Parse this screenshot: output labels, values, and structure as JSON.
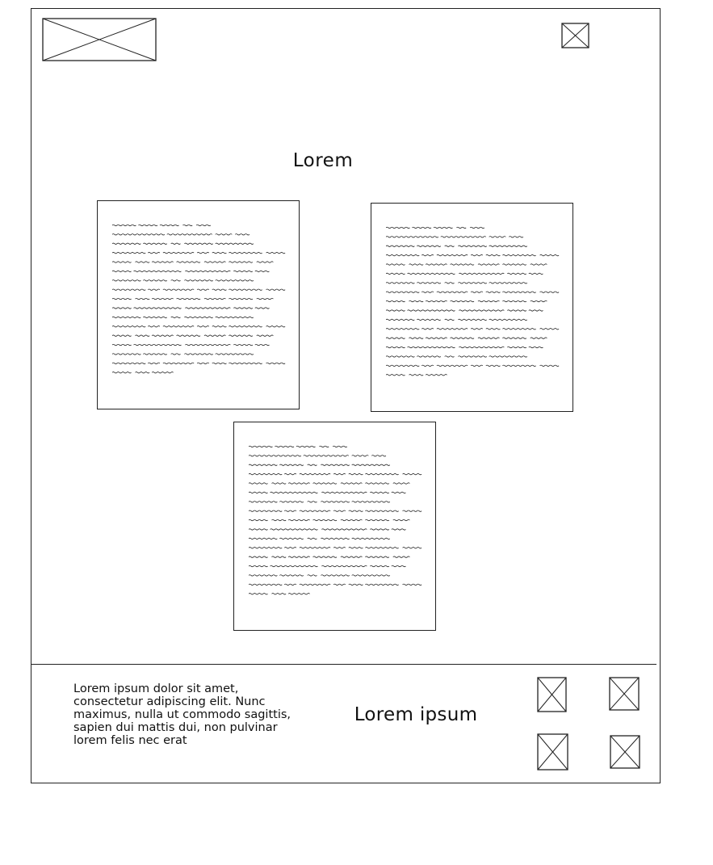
{
  "icons": {
    "logo": "image-placeholder-icon",
    "top_right": "image-placeholder-icon",
    "footer": [
      "image-placeholder-icon",
      "image-placeholder-icon",
      "image-placeholder-icon",
      "image-placeholder-icon"
    ]
  },
  "main": {
    "heading": "Lorem"
  },
  "footer": {
    "text": "Lorem ipsum dolor sit amet, consectetur adipiscing elit. Nunc maximus, nulla ut commodo sagittis, sapien dui mattis dui, non pulvinar lorem felis nec erat",
    "title": "Lorem ipsum"
  }
}
